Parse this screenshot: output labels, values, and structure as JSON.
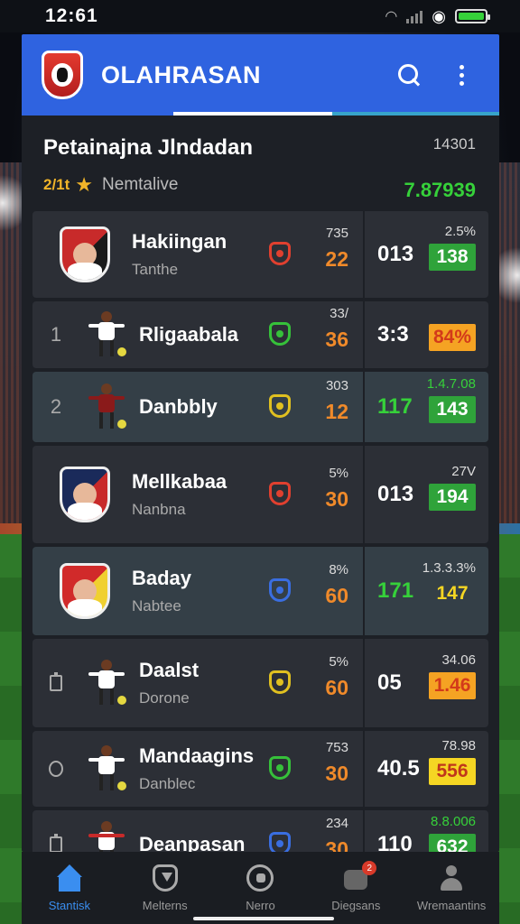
{
  "status_bar": {
    "time": "12:61"
  },
  "header": {
    "title": "OLAHRASAN"
  },
  "summary": {
    "title": "Petainajna Jlndadan",
    "count": "14301",
    "tag": "2/1t",
    "label": "Nemtalive",
    "value": "7.87939"
  },
  "teams": [
    {
      "rank": "",
      "name": "Hakiingan",
      "sub": "Tanthe",
      "stat_top": "735",
      "stat_main": "22",
      "side_top": "2.5%",
      "side_left": "013",
      "badge": "138",
      "shield_color": "#e0402f",
      "badge_style": "green",
      "side_left_color": "#ffffff",
      "side_top_color": "#dddddd"
    },
    {
      "rank": "1",
      "name": "Rligaabala",
      "sub": "",
      "stat_top": "33/",
      "stat_main": "36",
      "side_top": "",
      "side_left": "3:3",
      "badge": "84%",
      "shield_color": "#36c13a",
      "badge_style": "orange",
      "side_left_color": "#ffffff",
      "side_top_color": "#dddddd"
    },
    {
      "rank": "2",
      "name": "Danbbly",
      "sub": "",
      "stat_top": "303",
      "stat_main": "12",
      "side_top": "1.4.7.08",
      "side_left": "117",
      "badge": "143",
      "shield_color": "#e0c020",
      "badge_style": "green",
      "side_left_color": "#36d13a",
      "side_top_color": "#36d13a"
    },
    {
      "rank": "",
      "name": "Mellkabaa",
      "sub": "Nanbna",
      "stat_top": "5%",
      "stat_main": "30",
      "side_top": "27V",
      "side_left": "013",
      "badge": "194",
      "shield_color": "#e0402f",
      "badge_style": "green",
      "side_left_color": "#ffffff",
      "side_top_color": "#dddddd"
    },
    {
      "rank": "",
      "name": "Baday",
      "sub": "Nabtee",
      "stat_top": "8%",
      "stat_main": "60",
      "side_top": "1.3.3.3%",
      "side_left": "171",
      "badge": "147",
      "shield_color": "#3a6ee0",
      "badge_style": "plain",
      "side_left_color": "#36d13a",
      "side_top_color": "#dddddd"
    },
    {
      "rank": "",
      "name": "Daalst",
      "sub": "Dorone",
      "stat_top": "5%",
      "stat_main": "60",
      "side_top": "34.06",
      "side_left": "05",
      "badge": "1.46",
      "shield_color": "#e0c020",
      "badge_style": "orange",
      "side_left_color": "#ffffff",
      "side_top_color": "#dddddd"
    },
    {
      "rank": "",
      "name": "Mandaagins",
      "sub": "Danblec",
      "stat_top": "753",
      "stat_main": "30",
      "side_top": "78.98",
      "side_left": "40.5",
      "badge": "556",
      "shield_color": "#36c13a",
      "badge_style": "yellow",
      "side_left_color": "#ffffff",
      "side_top_color": "#dddddd"
    },
    {
      "rank": "",
      "name": "Deanpasan",
      "sub": "",
      "stat_top": "234",
      "stat_main": "30",
      "side_top": "8.8.006",
      "side_left": "110",
      "badge": "632",
      "shield_color": "#3a6ee0",
      "badge_style": "green",
      "side_left_color": "#ffffff",
      "side_top_color": "#36d13a"
    }
  ],
  "nav": [
    {
      "label": "Stantisk",
      "icon": "home-icon"
    },
    {
      "label": "Melterns",
      "icon": "shield-icon"
    },
    {
      "label": "Nerro",
      "icon": "ball-icon"
    },
    {
      "label": "Diegsans",
      "icon": "team-icon",
      "badge": "2"
    },
    {
      "label": "Wremaantins",
      "icon": "person-icon"
    }
  ]
}
